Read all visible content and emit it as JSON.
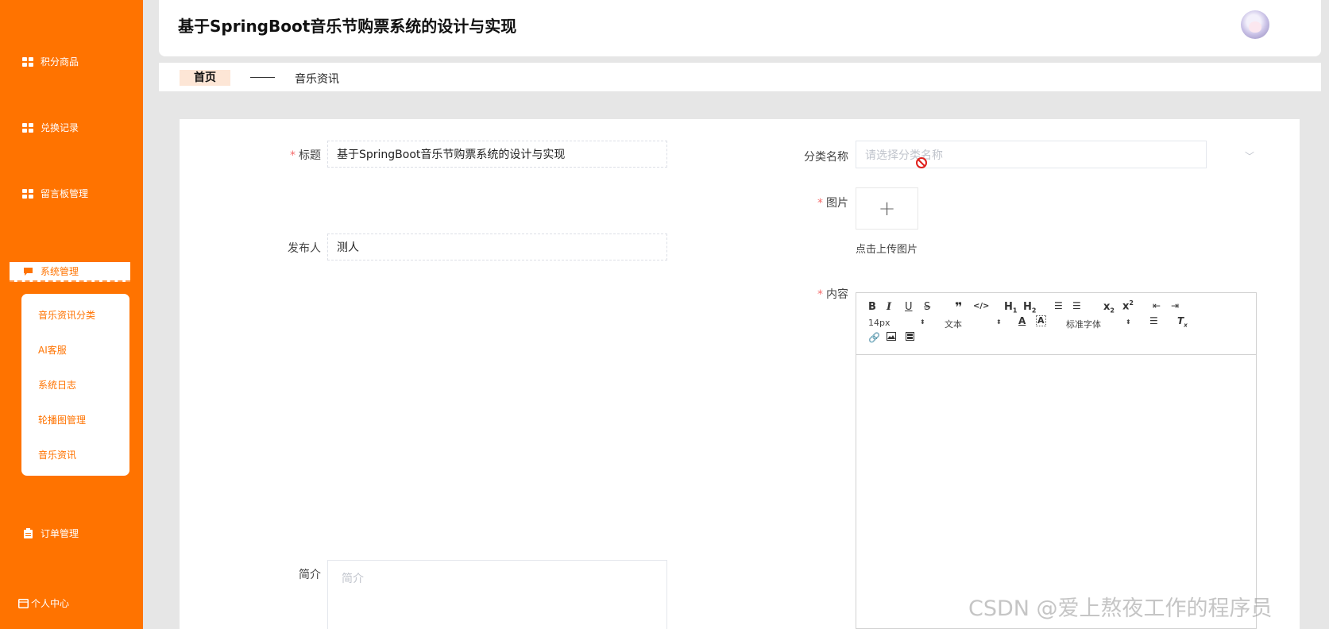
{
  "sidebar": {
    "items": [
      {
        "label": "积分商品",
        "icon": "grid-icon"
      },
      {
        "label": "兑换记录",
        "icon": "grid-icon"
      },
      {
        "label": "留言板管理",
        "icon": "grid-icon"
      },
      {
        "label": "系统管理",
        "icon": "message-icon",
        "active": true
      },
      {
        "label": "订单管理",
        "icon": "clipboard-icon"
      },
      {
        "label": "个人中心",
        "icon": "calendar-icon"
      }
    ],
    "submenu": [
      "音乐资讯分类",
      "AI客服",
      "系统日志",
      "轮播图管理",
      "音乐资讯"
    ]
  },
  "header": {
    "title": "基于SpringBoot音乐节购票系统的设计与实现"
  },
  "breadcrumb": {
    "home": "首页",
    "current": "音乐资讯"
  },
  "form": {
    "title_label": "标题",
    "title_value": "基于SpringBoot音乐节购票系统的设计与实现",
    "publisher_label": "发布人",
    "publisher_value": "测人",
    "intro_label": "简介",
    "intro_placeholder": "简介",
    "category_label": "分类名称",
    "category_placeholder": "请选择分类名称",
    "image_label": "图片",
    "upload_tip": "点击上传图片",
    "content_label": "内容"
  },
  "editor": {
    "font_size": "14px",
    "paragraph": "文本",
    "font_family": "标准字体"
  },
  "watermark": "CSDN @爱上熬夜工作的程序员",
  "colors": {
    "accent": "#ff7300",
    "required": "#f56c6c"
  }
}
